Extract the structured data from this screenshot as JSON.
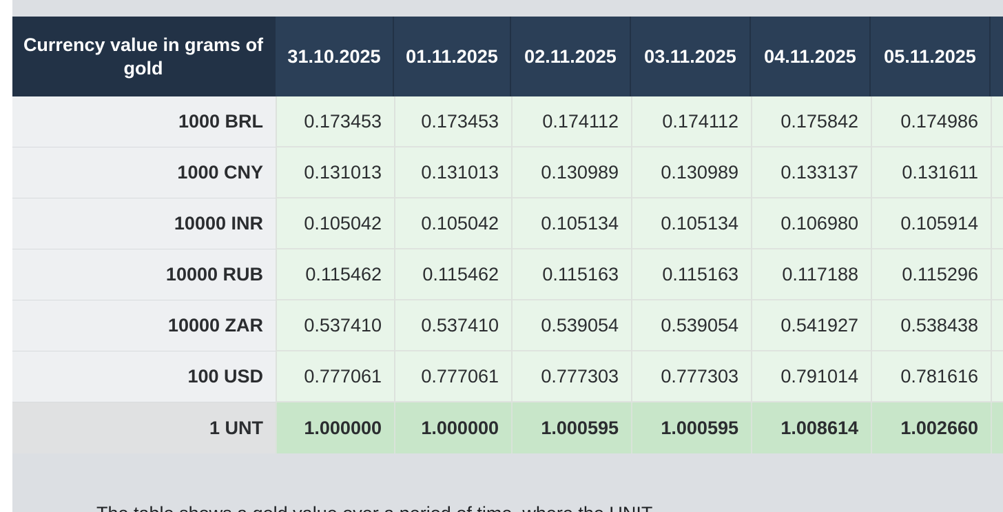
{
  "table": {
    "corner_header": "Currency value in grams of gold",
    "dates": [
      "31.10.2025",
      "01.11.2025",
      "02.11.2025",
      "03.11.2025",
      "04.11.2025",
      "05.11.2025"
    ],
    "rows": [
      {
        "label": "1000 BRL",
        "values": [
          "0.173453",
          "0.173453",
          "0.174112",
          "0.174112",
          "0.175842",
          "0.174986"
        ]
      },
      {
        "label": "1000 CNY",
        "values": [
          "0.131013",
          "0.131013",
          "0.130989",
          "0.130989",
          "0.133137",
          "0.131611"
        ]
      },
      {
        "label": "10000 INR",
        "values": [
          "0.105042",
          "0.105042",
          "0.105134",
          "0.105134",
          "0.106980",
          "0.105914"
        ]
      },
      {
        "label": "10000 RUB",
        "values": [
          "0.115462",
          "0.115462",
          "0.115163",
          "0.115163",
          "0.117188",
          "0.115296"
        ]
      },
      {
        "label": "10000 ZAR",
        "values": [
          "0.537410",
          "0.537410",
          "0.539054",
          "0.539054",
          "0.541927",
          "0.538438"
        ]
      },
      {
        "label": "100 USD",
        "values": [
          "0.777061",
          "0.777061",
          "0.777303",
          "0.777303",
          "0.791014",
          "0.781616"
        ]
      }
    ],
    "total_row": {
      "label": "1 UNT",
      "values": [
        "1.000000",
        "1.000000",
        "1.000595",
        "1.000595",
        "1.008614",
        "1.002660"
      ]
    }
  },
  "caption": "The table shows a gold value over a period of time, where the UNIT"
}
